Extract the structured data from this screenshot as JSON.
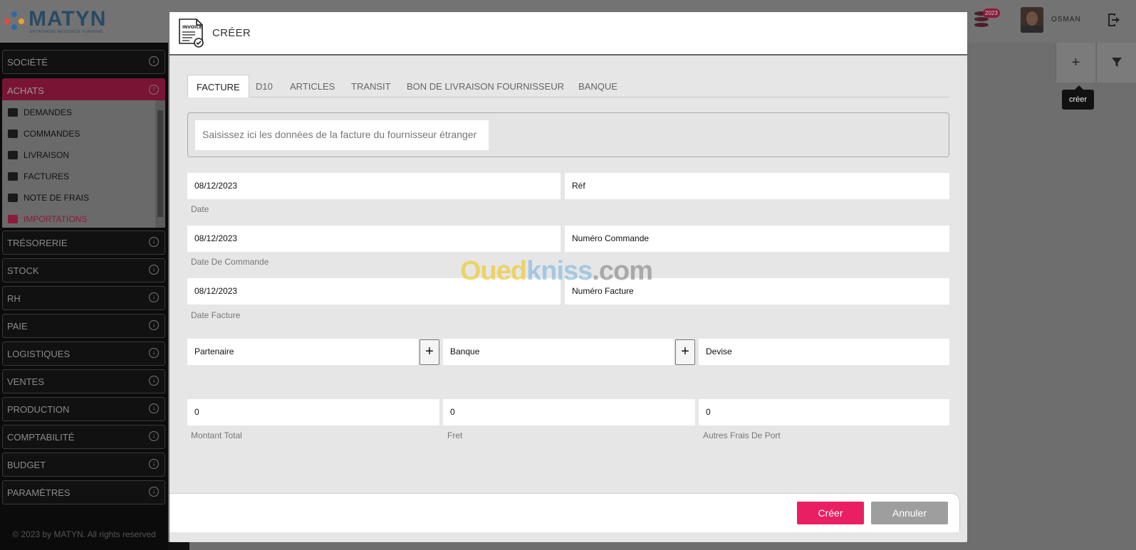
{
  "app": {
    "logo_name": "MATYN",
    "logo_tagline": "ENTREPRISE RESOURCE PLANNING",
    "user_name": "OSMAN",
    "notification_badge": "2023"
  },
  "sidebar": {
    "items": [
      {
        "label": "SOCIÉTÉ"
      },
      {
        "label": "ACHATS"
      },
      {
        "label": "TRÉSORERIE"
      },
      {
        "label": "STOCK"
      },
      {
        "label": "RH"
      },
      {
        "label": "PAIE"
      },
      {
        "label": "LOGISTIQUES"
      },
      {
        "label": "VENTES"
      },
      {
        "label": "PRODUCTION"
      },
      {
        "label": "COMPTABILITÉ"
      },
      {
        "label": "BUDGET"
      },
      {
        "label": "PARAMÈTRES"
      }
    ],
    "achats_sub": [
      {
        "label": "DEMANDES"
      },
      {
        "label": "COMMANDES"
      },
      {
        "label": "LIVRAISON"
      },
      {
        "label": "FACTURES"
      },
      {
        "label": "NOTE DE FRAIS"
      },
      {
        "label": "IMPORTATIONS"
      }
    ],
    "footer": "© 2023 by MATYN. All rights reserved"
  },
  "toolbar": {
    "tooltip": "créer"
  },
  "modal": {
    "title": "CRÉER",
    "invoice_icon_label": "INVOICE",
    "tabs": [
      {
        "label": "FACTURE"
      },
      {
        "label": "D10"
      },
      {
        "label": "ARTICLES"
      },
      {
        "label": "TRANSIT"
      },
      {
        "label": "BON DE LIVRAISON FOURNISSEUR"
      },
      {
        "label": "BANQUE"
      }
    ],
    "description": "Saisissez ici les données de la facture du fournisseur étranger",
    "fields": {
      "date": {
        "value": "08/12/2023",
        "label": "Date"
      },
      "ref": {
        "value": "Réf"
      },
      "date_commande": {
        "value": "08/12/2023",
        "label": "Date De Commande"
      },
      "numero_commande": {
        "value": "Numéro Commande"
      },
      "date_facture": {
        "value": "08/12/2023",
        "label": "Date Facture"
      },
      "numero_facture": {
        "value": "Numéro Facture"
      },
      "partenaire": {
        "value": "Partenaire"
      },
      "banque": {
        "value": "Banque"
      },
      "devise": {
        "value": "Devise"
      },
      "montant_total": {
        "value": "0",
        "label": "Montant Total"
      },
      "fret": {
        "value": "0",
        "label": "Fret"
      },
      "autres_frais": {
        "value": "0",
        "label": "Autres Frais De Port"
      }
    },
    "buttons": {
      "create": "Créer",
      "cancel": "Annuler"
    }
  },
  "watermark": {
    "part1": "Oued",
    "part2": "kniss",
    "part3": ".com"
  },
  "colors": {
    "accent": "#e91e63",
    "brand": "#2a4a63",
    "active_menu": "#7a1434"
  }
}
